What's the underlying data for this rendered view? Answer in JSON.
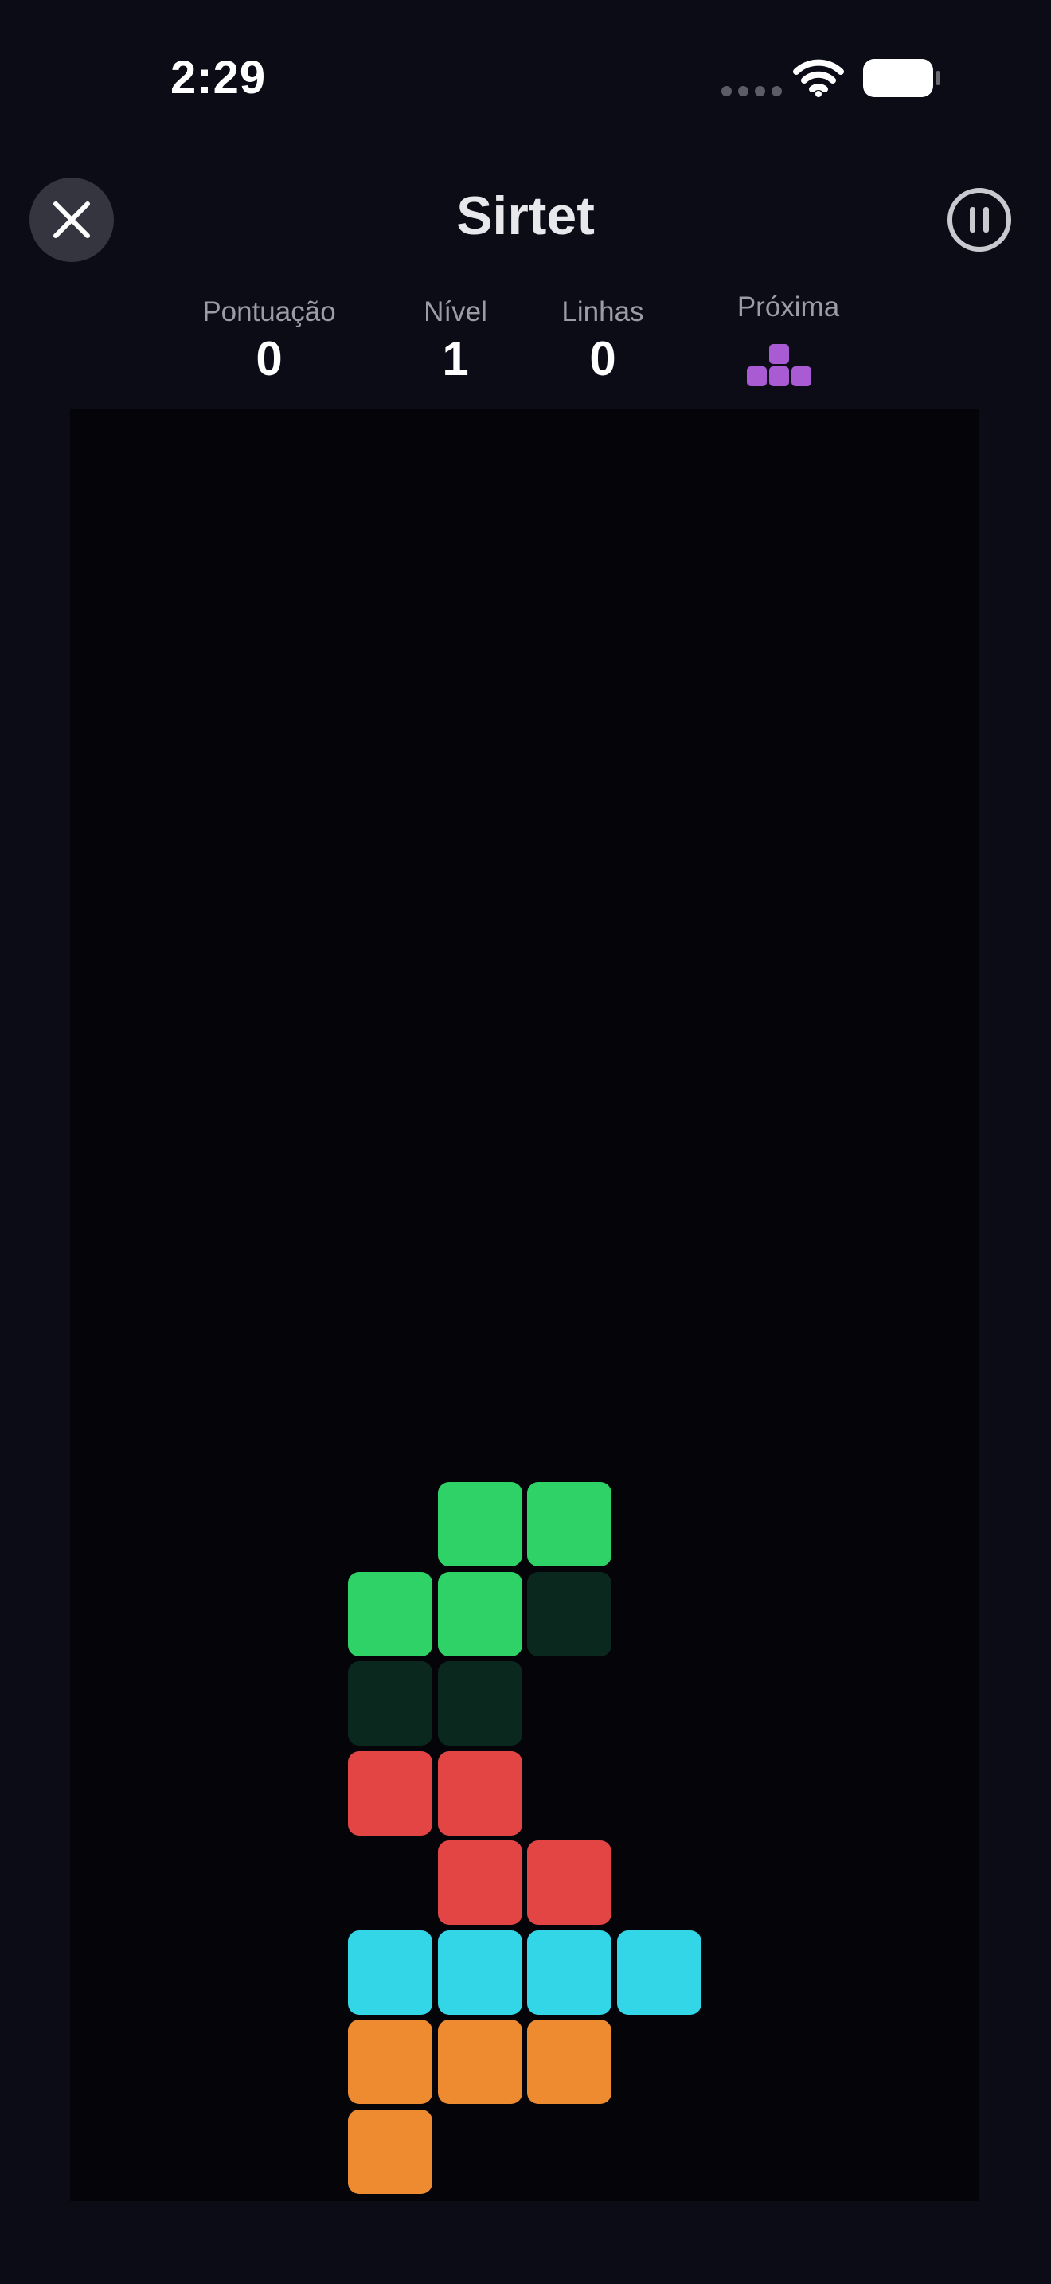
{
  "status_bar": {
    "time": "2:29",
    "signal_icon": "cellular-dots-icon",
    "wifi_icon": "wifi-icon",
    "battery_icon": "battery-icon"
  },
  "header": {
    "title": "Sirtet",
    "close_icon": "close-icon",
    "pause_icon": "pause-icon"
  },
  "stats": {
    "score_label": "Pontuação",
    "score_value": "0",
    "level_label": "Nível",
    "level_value": "1",
    "lines_label": "Linhas",
    "lines_value": "0",
    "next_label": "Próxima",
    "next_piece": {
      "shape": "T",
      "color": "#a95bd4",
      "blocks": [
        [
          1,
          0
        ],
        [
          0,
          1
        ],
        [
          1,
          1
        ],
        [
          2,
          1
        ]
      ]
    }
  },
  "board": {
    "columns": 10,
    "rows": 20,
    "background": "#050509",
    "cells": [
      {
        "col": 4,
        "row": 12,
        "color": "#2fd266",
        "kind": "active"
      },
      {
        "col": 5,
        "row": 12,
        "color": "#2fd266",
        "kind": "active"
      },
      {
        "col": 3,
        "row": 13,
        "color": "#2fd266",
        "kind": "active"
      },
      {
        "col": 4,
        "row": 13,
        "color": "#2fd266",
        "kind": "active"
      },
      {
        "col": 5,
        "row": 13,
        "color": "#0b281e",
        "kind": "ghost"
      },
      {
        "col": 3,
        "row": 14,
        "color": "#0b281e",
        "kind": "ghost"
      },
      {
        "col": 4,
        "row": 14,
        "color": "#0b281e",
        "kind": "ghost"
      },
      {
        "col": 3,
        "row": 15,
        "color": "#e34545",
        "kind": "locked"
      },
      {
        "col": 4,
        "row": 15,
        "color": "#e34545",
        "kind": "locked"
      },
      {
        "col": 4,
        "row": 16,
        "color": "#e34545",
        "kind": "locked"
      },
      {
        "col": 5,
        "row": 16,
        "color": "#e34545",
        "kind": "locked"
      },
      {
        "col": 3,
        "row": 17,
        "color": "#33d6e6",
        "kind": "locked"
      },
      {
        "col": 4,
        "row": 17,
        "color": "#33d6e6",
        "kind": "locked"
      },
      {
        "col": 5,
        "row": 17,
        "color": "#33d6e6",
        "kind": "locked"
      },
      {
        "col": 6,
        "row": 17,
        "color": "#33d6e6",
        "kind": "locked"
      },
      {
        "col": 3,
        "row": 18,
        "color": "#ee8a30",
        "kind": "locked"
      },
      {
        "col": 4,
        "row": 18,
        "color": "#ee8a30",
        "kind": "locked"
      },
      {
        "col": 5,
        "row": 18,
        "color": "#ee8a30",
        "kind": "locked"
      },
      {
        "col": 3,
        "row": 19,
        "color": "#ee8a30",
        "kind": "locked"
      }
    ]
  }
}
